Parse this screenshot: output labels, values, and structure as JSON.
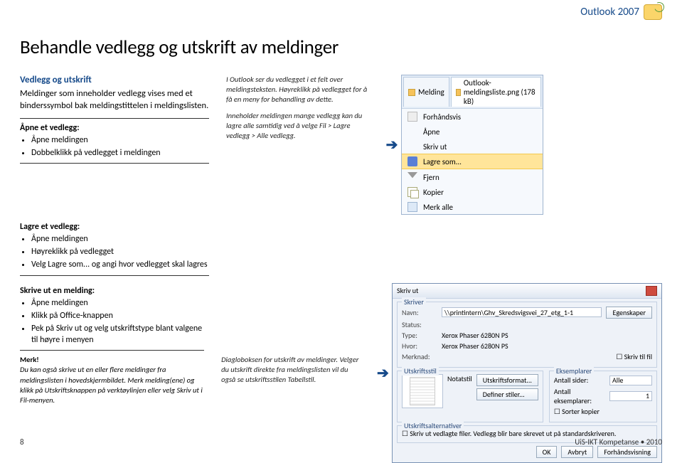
{
  "brand": {
    "name": "Outlook 2007"
  },
  "page_title": "Behandle vedlegg og utskrift av meldinger",
  "section1": {
    "heading": "Vedlegg og utskrift",
    "intro": "Meldinger som inneholder vedlegg vises med et binderssymbol bak meldingstittelen i meldingslisten.",
    "open": {
      "head": "Åpne et vedlegg:",
      "items": [
        "Åpne meldingen",
        "Dobbelklikk på vedlegget i meldingen"
      ]
    },
    "caption": {
      "p1": "I Outlook ser du vedlegget i et felt over meldingsteksten. Høyreklikk på vedlegget for å få en meny for behandling av dette.",
      "p2": "Inneholder meldingen mange vedlegg kan du lagre alle samtidig ved å velge Fil > Lagre vedlegg > Alle vedlegg."
    },
    "menu": {
      "tab1": "Melding",
      "tab2": "Outlook-meldingsliste.png (178 kB)",
      "items": [
        "Forhåndsvis",
        "Åpne",
        "Skriv ut",
        "Lagre som...",
        "Fjern",
        "Kopier",
        "Merk alle"
      ]
    }
  },
  "section2": {
    "head": "Lagre et vedlegg:",
    "items": [
      "Åpne meldingen",
      "Høyreklikk på vedlegget",
      "Velg Lagre som... og angi hvor vedlegget skal lagres"
    ]
  },
  "section3": {
    "head": "Skrive ut en melding:",
    "items": [
      "Åpne meldingen",
      "Klikk på Office-knappen",
      "Pek på Skriv ut og velg utskriftstype blant valgene til høyre i menyen"
    ],
    "note_head": "Merk!",
    "note": "Du kan også skrive ut en eller flere meldinger fra meldingslisten i hovedskjermbildet. Merk melding(ene) og klikk på Utskriftsknappen på verktøylinjen eller velg Skriv ut i Fil-menyen.",
    "caption": "Diagloboksen for utskrift av meldinger. Velger du utskrift direkte fra meldingslisten vil du også se utskriftsstilen Tabellstil.",
    "dialog": {
      "title": "Skriv ut",
      "printer_group": "Skriver",
      "navn": "Navn:",
      "navn_val": "\\\\printintern\\Ghv_Skredsvigsvei_27_etg_1-1",
      "egenskaper": "Egenskaper",
      "status": "Status:",
      "hvor": "Hvor:",
      "merknad": "Merknad:",
      "type": "Type:",
      "type_val": "Xerox Phaser 6280N PS",
      "hvor_val": "Xerox Phaser 6280N PS",
      "skriv_til_fil": "Skriv til fil",
      "style_group": "Utskriftsstil",
      "style_val": "Notatstil",
      "style_btn1": "Utskriftsformat...",
      "style_btn2": "Definer stiler...",
      "copies_group": "Eksemplarer",
      "antall_sider": "Antall sider:",
      "alle": "Alle",
      "antall_eks": "Antall eksemplarer:",
      "antall_eks_val": "1",
      "sorter": "Sorter kopier",
      "alt_group": "Utskriftsalternativer",
      "alt_chk": "Skriv ut vedlagte filer. Vedlegg blir bare skrevet ut på standardskriveren.",
      "ok": "OK",
      "cancel": "Avbryt",
      "preview": "Forhåndsvisning"
    }
  },
  "footer": {
    "page": "8",
    "credit": "UiS-IKT Kompetanse • 2010"
  }
}
